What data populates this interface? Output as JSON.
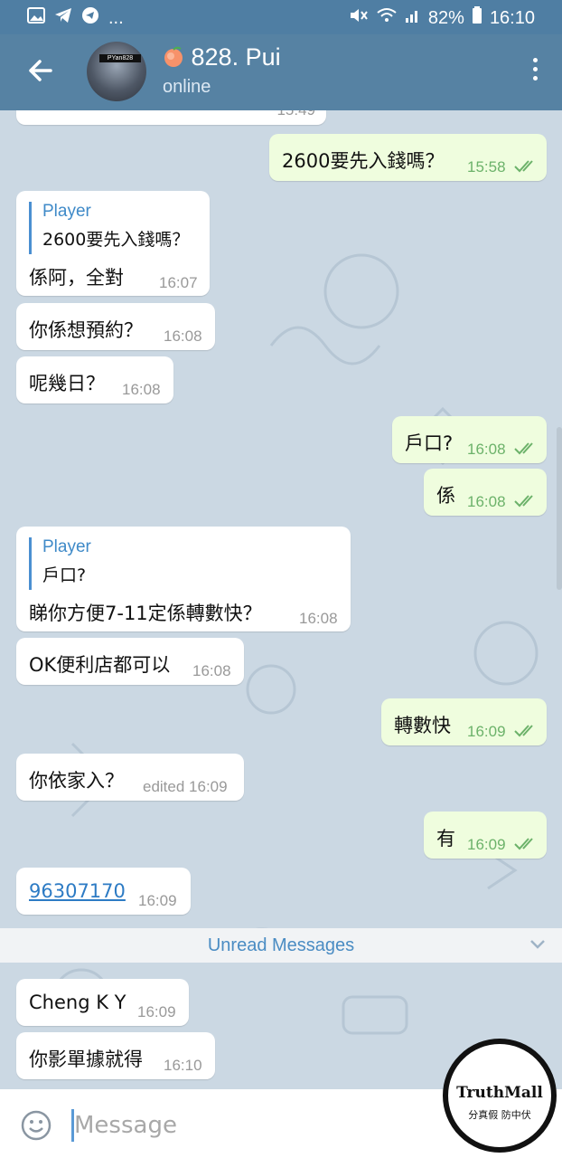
{
  "status_bar": {
    "ellipsis": "...",
    "battery": "82%",
    "time": "16:10"
  },
  "header": {
    "title": "828. Pui",
    "status": "online",
    "avatar_tag": "PYan828"
  },
  "messages": [
    {
      "dir": "in",
      "text": "",
      "time": "15:49"
    },
    {
      "dir": "out",
      "text": "2600要先入錢嗎？",
      "time": "15:58"
    },
    {
      "dir": "in",
      "reply_name": "Player",
      "reply_text": "2600要先入錢嗎？",
      "text": "係阿，全對",
      "time": "16:07"
    },
    {
      "dir": "in",
      "text": "你係想預約？",
      "time": "16:08"
    },
    {
      "dir": "in",
      "text": "呢幾日？",
      "time": "16:08"
    },
    {
      "dir": "out",
      "text": "戶口?",
      "time": "16:08"
    },
    {
      "dir": "out",
      "text": "係",
      "time": "16:08"
    },
    {
      "dir": "in",
      "reply_name": "Player",
      "reply_text": "戶口?",
      "text": "睇你方便7-11定係轉數快？",
      "time": "16:08"
    },
    {
      "dir": "in",
      "text": "OK便利店都可以",
      "time": "16:08"
    },
    {
      "dir": "out",
      "text": "轉數快",
      "time": "16:09"
    },
    {
      "dir": "in",
      "text": "你依家入？",
      "time": "edited 16:09"
    },
    {
      "dir": "out",
      "text": "有",
      "time": "16:09"
    },
    {
      "dir": "in",
      "text": "96307170",
      "time": "16:09",
      "is_link": true
    },
    {
      "dir": "in",
      "text": "Cheng K Y",
      "time": "16:09"
    },
    {
      "dir": "in",
      "text": "你影單據就得",
      "time": "16:10"
    }
  ],
  "divider": {
    "label": "Unread Messages"
  },
  "composer": {
    "placeholder": "Message"
  },
  "watermark": {
    "line1": "TruthMall",
    "line2": "分真假 防中伏"
  },
  "colors": {
    "header": "#5682a3",
    "status_bar": "#4f7ea3",
    "incoming": "#ffffff",
    "outgoing": "#effdde",
    "accent": "#3f8ac8"
  }
}
